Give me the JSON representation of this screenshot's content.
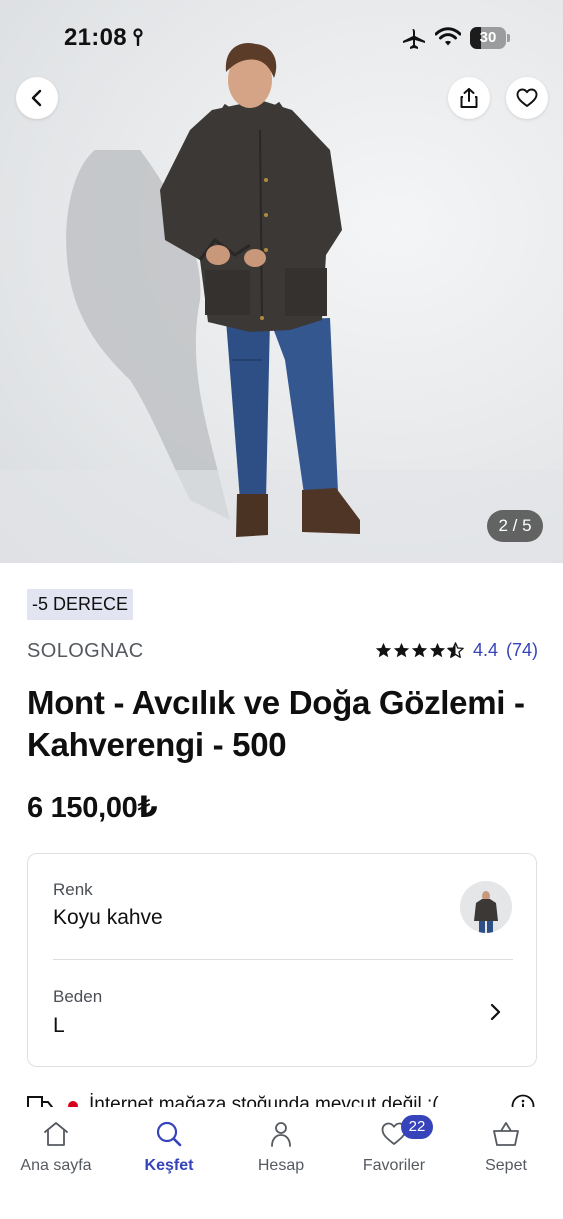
{
  "status_bar": {
    "time": "21:08",
    "battery_level": "30",
    "icons": [
      "location-arrow-icon",
      "airplane-icon",
      "wifi-icon",
      "battery-icon"
    ]
  },
  "gallery": {
    "counter": "2 / 5",
    "current_index": 2,
    "total": 5
  },
  "product": {
    "badge": "-5 DERECE",
    "brand": "SOLOGNAC",
    "rating_value": "4.4",
    "rating_count": "(74)",
    "title": "Mont - Avcılık ve Doğa Gözlemi - Kahverengi - 500",
    "price": "6 150,00₺"
  },
  "options": {
    "color_label": "Renk",
    "color_value": "Koyu kahve",
    "size_label": "Beden",
    "size_value": "L"
  },
  "stock": {
    "message": "İnternet mağaza stoğunda mevcut değil :("
  },
  "bottom_nav": {
    "items": [
      {
        "label": "Ana sayfa",
        "icon": "home-icon"
      },
      {
        "label": "Keşfet",
        "icon": "search-icon",
        "active": true
      },
      {
        "label": "Hesap",
        "icon": "user-icon"
      },
      {
        "label": "Favoriler",
        "icon": "heart-icon",
        "badge": "22"
      },
      {
        "label": "Sepet",
        "icon": "basket-icon"
      }
    ]
  },
  "colors": {
    "accent": "#3643ba",
    "badge_bg": "#e3e4f2",
    "stock_dot": "#d6001c",
    "text": "#101010",
    "muted": "#555a60"
  }
}
